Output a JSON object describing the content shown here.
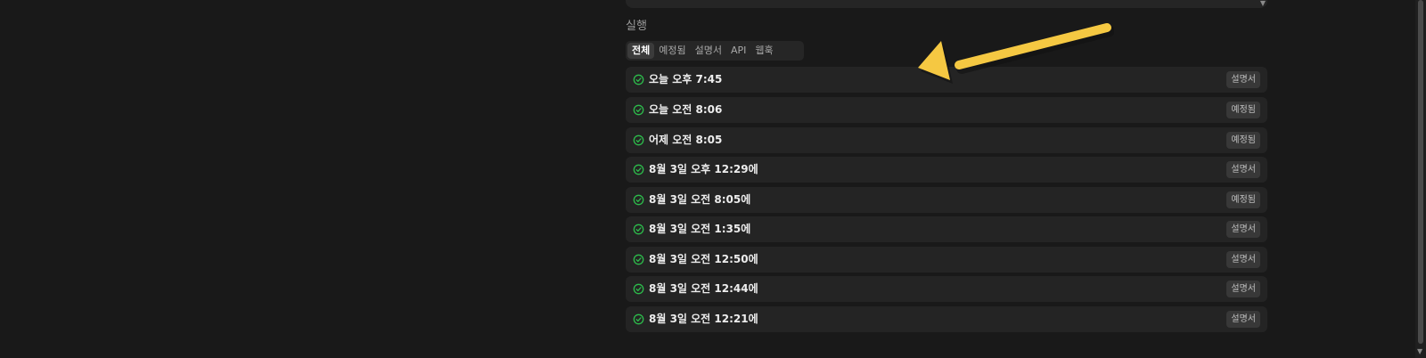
{
  "section": {
    "label": "실행"
  },
  "tabs": [
    {
      "label": "전체",
      "active": true
    },
    {
      "label": "예정됨",
      "active": false
    },
    {
      "label": "설명서",
      "active": false
    },
    {
      "label": "API",
      "active": false
    },
    {
      "label": "웹훅",
      "active": false
    }
  ],
  "runs": [
    {
      "time": "오늘 오후 7:45",
      "badge": "설명서",
      "status_icon": "check-circle-icon"
    },
    {
      "time": "오늘 오전 8:06",
      "badge": "예정됨",
      "status_icon": "check-circle-icon"
    },
    {
      "time": "어제 오전 8:05",
      "badge": "예정됨",
      "status_icon": "check-circle-icon"
    },
    {
      "time": "8월 3일 오후 12:29에",
      "badge": "설명서",
      "status_icon": "check-circle-icon"
    },
    {
      "time": "8월 3일 오전 8:05에",
      "badge": "예정됨",
      "status_icon": "check-circle-icon"
    },
    {
      "time": "8월 3일 오전 1:35에",
      "badge": "설명서",
      "status_icon": "check-circle-icon"
    },
    {
      "time": "8월 3일 오전 12:50에",
      "badge": "설명서",
      "status_icon": "check-circle-icon"
    },
    {
      "time": "8월 3일 오전 12:44에",
      "badge": "설명서",
      "status_icon": "check-circle-icon"
    },
    {
      "time": "8월 3일 오전 12:21에",
      "badge": "설명서",
      "status_icon": "check-circle-icon"
    }
  ],
  "colors": {
    "background": "#191919",
    "row_background": "#242424",
    "success_green": "#2dbb4b",
    "annotation_arrow": "#f5c842"
  }
}
